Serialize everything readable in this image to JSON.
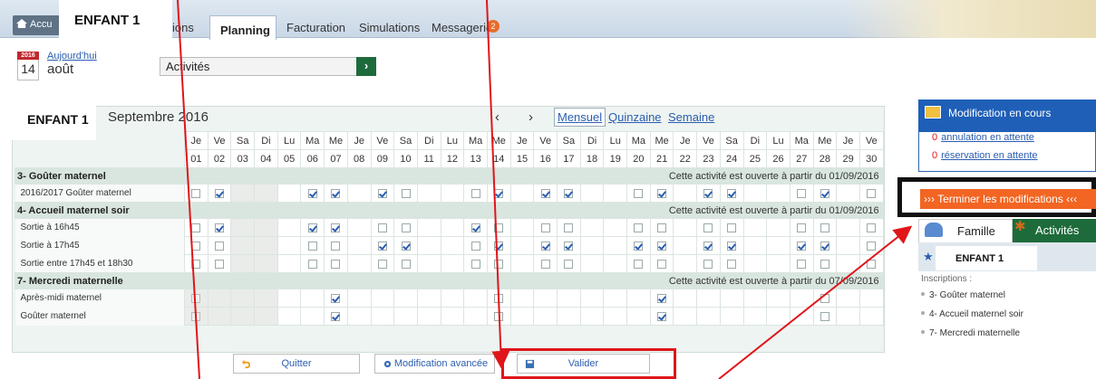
{
  "topbar": {
    "home_label": "Accu",
    "tab_partial": "ions",
    "tabs": [
      "Planning",
      "Facturation",
      "Simulations",
      "Messagerie"
    ],
    "messages_count": "2",
    "overlay_child": "ENFANT 1"
  },
  "date": {
    "year": "2016",
    "day": "14",
    "month": "août",
    "today_link": "Aujourd'hui"
  },
  "activities_select": {
    "value": "Activités",
    "go": "›"
  },
  "planning": {
    "child": "ENFANT 1",
    "month_title": "Septembre 2016",
    "prev": "‹",
    "next": "›",
    "views": [
      "Mensuel",
      "Quinzaine",
      "Semaine"
    ],
    "weekdays": [
      "Je",
      "Ve",
      "Sa",
      "Di",
      "Lu",
      "Ma",
      "Me",
      "Je",
      "Ve",
      "Sa",
      "Di",
      "Lu",
      "Ma",
      "Me",
      "Je",
      "Ve",
      "Sa",
      "Di",
      "Lu",
      "Ma",
      "Me",
      "Je",
      "Ve",
      "Sa",
      "Di",
      "Lu",
      "Ma",
      "Me",
      "Je",
      "Ve"
    ],
    "days": [
      "01",
      "02",
      "03",
      "04",
      "05",
      "06",
      "07",
      "08",
      "09",
      "10",
      "11",
      "12",
      "13",
      "14",
      "15",
      "16",
      "17",
      "18",
      "19",
      "20",
      "21",
      "22",
      "23",
      "24",
      "25",
      "26",
      "27",
      "28",
      "29",
      "30"
    ],
    "sections": [
      {
        "name": "3- Goûter maternel",
        "note": "Cette activité est ouverte à partir du 01/09/2016",
        "rows": [
          {
            "label": "2016/2017 Goûter maternel",
            "pattern": "cCgg.CC.Cc..cC.CC..cC.CC..cC.cc"
          }
        ]
      },
      {
        "name": "4- Accueil maternel soir",
        "note": "Cette activité est ouverte à partir du 01/09/2016",
        "rows": [
          {
            "label": "Sortie à 16h45",
            "pattern": "cCgg.CC.cc..Cc.cc..cc.cc..cc.cc"
          },
          {
            "label": "Sortie à 17h45",
            "pattern": "ccgg.cc.CC..cC.CC..CC.CC..CC.cc"
          },
          {
            "label": "Sortie entre 17h45 et 18h30",
            "pattern": "ccgg.cc.cc..cc.cc..cc.cc..cc.cc"
          }
        ]
      },
      {
        "name": "7- Mercredi maternelle",
        "note": "Cette activité est ouverte à partir du 07/09/2016",
        "rows": [
          {
            "label": "Après-midi maternel",
            "pattern": "gggg..C......c......C......c.."
          },
          {
            "label": "Goûter maternel",
            "pattern": "gggg..C......c......C......c.."
          }
        ]
      }
    ]
  },
  "buttons": {
    "quit": "Quitter",
    "advanced": "Modification avancée",
    "validate": "Valider"
  },
  "modifications": {
    "title": "Modification en cours",
    "cancel_count": "0",
    "cancel_text": "annulation en attente",
    "reserve_count": "0",
    "reserve_text": "réservation en attente",
    "finish": "››› Terminer les modifications ‹‹‹"
  },
  "family_panel": {
    "tab_family": "Famille",
    "tab_activities": "Activités",
    "child": "ENFANT 1",
    "inscriptions_title": "Inscriptions :",
    "inscriptions": [
      "3- Goûter maternel",
      "4- Accueil maternel soir",
      "7- Mercredi maternelle"
    ]
  },
  "colors": {
    "accent_blue": "#1f5fb8",
    "orange": "#f26522",
    "green": "#1d6b3b",
    "highlight_red": "#e0151a"
  }
}
